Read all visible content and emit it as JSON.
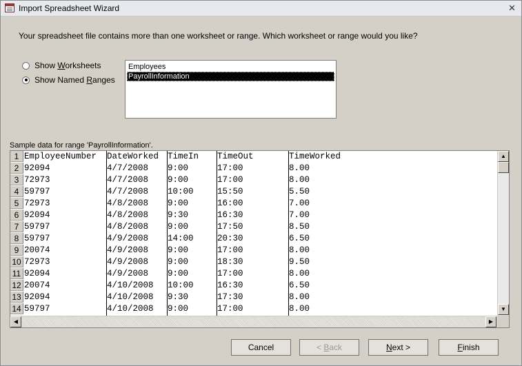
{
  "window": {
    "title": "Import Spreadsheet Wizard"
  },
  "question": "Your spreadsheet file contains more than one worksheet or range. Which worksheet or range would you like?",
  "radios": [
    {
      "prefix": "Show ",
      "mnemonic": "W",
      "suffix": "orksheets",
      "checked": false
    },
    {
      "prefix": "Show Named ",
      "mnemonic": "R",
      "suffix": "anges",
      "checked": true
    }
  ],
  "ranges": [
    {
      "label": "Employees",
      "selected": false
    },
    {
      "label": "PayrollInformation",
      "selected": true
    }
  ],
  "sample_label": "Sample data for range 'PayrollInformation'.",
  "grid": {
    "row_numbers": [
      "1",
      "2",
      "3",
      "4",
      "5",
      "6",
      "7",
      "8",
      "9",
      "10",
      "11",
      "12",
      "13",
      "14"
    ],
    "rows": [
      [
        "EmployeeNumber",
        "DateWorked",
        "TimeIn",
        "TimeOut",
        "TimeWorked"
      ],
      [
        "92094",
        "4/7/2008",
        "9:00",
        "17:00",
        "8.00"
      ],
      [
        "72973",
        "4/7/2008",
        "9:00",
        "17:00",
        "8.00"
      ],
      [
        "59797",
        "4/7/2008",
        "10:00",
        "15:50",
        "5.50"
      ],
      [
        "72973",
        "4/8/2008",
        "9:00",
        "16:00",
        "7.00"
      ],
      [
        "92094",
        "4/8/2008",
        "9:30",
        "16:30",
        "7.00"
      ],
      [
        "59797",
        "4/8/2008",
        "9:00",
        "17:50",
        "8.50"
      ],
      [
        "59797",
        "4/9/2008",
        "14:00",
        "20:30",
        "6.50"
      ],
      [
        "20074",
        "4/9/2008",
        "9:00",
        "17:00",
        "8.00"
      ],
      [
        "72973",
        "4/9/2008",
        "9:00",
        "18:30",
        "9.50"
      ],
      [
        "92094",
        "4/9/2008",
        "9:00",
        "17:00",
        "8.00"
      ],
      [
        "20074",
        "4/10/2008",
        "10:00",
        "16:30",
        "6.50"
      ],
      [
        "92094",
        "4/10/2008",
        "9:30",
        "17:30",
        "8.00"
      ],
      [
        "59797",
        "4/10/2008",
        "9:00",
        "17:00",
        "8.00"
      ]
    ]
  },
  "buttons": {
    "cancel": "Cancel",
    "back_prefix": "< ",
    "back_mnemonic": "B",
    "back_suffix": "ack",
    "next_mnemonic": "N",
    "next_suffix": "ext >",
    "finish_mnemonic": "F",
    "finish_suffix": "inish"
  }
}
